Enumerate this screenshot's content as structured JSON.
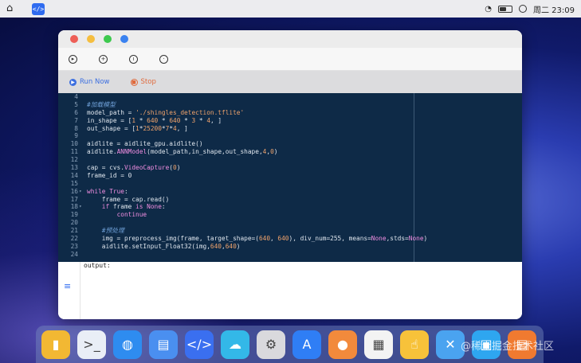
{
  "menubar": {
    "clock": "周二 23:09",
    "battery_level": 0.6
  },
  "window": {
    "toolbar_icons": [
      "play-circle-icon",
      "add-circle-icon",
      "clock-icon",
      "settings-icon"
    ],
    "actions": {
      "run_label": "Run Now",
      "stop_label": "Stop"
    }
  },
  "editor": {
    "lines": [
      {
        "n": "4",
        "text": ""
      },
      {
        "n": "5",
        "text": "#加载模型"
      },
      {
        "n": "6",
        "text": "model_path = './shingles_detection.tflite'"
      },
      {
        "n": "7",
        "text": "in_shape = [1 * 640 * 640 * 3 * 4, ]"
      },
      {
        "n": "8",
        "text": "out_shape = [1*25200*7*4, ]"
      },
      {
        "n": "9",
        "text": ""
      },
      {
        "n": "10",
        "text": "aidlite = aidlite_gpu.aidlite()"
      },
      {
        "n": "11",
        "text": "aidlite.ANNModel(model_path,in_shape,out_shape,4,0)"
      },
      {
        "n": "12",
        "text": ""
      },
      {
        "n": "13",
        "text": "cap = cvs.VideoCapture(0)"
      },
      {
        "n": "14",
        "text": "frame_id = 0"
      },
      {
        "n": "15",
        "text": ""
      },
      {
        "n": "16",
        "text": "while True:"
      },
      {
        "n": "17",
        "text": "    frame = cap.read()"
      },
      {
        "n": "18",
        "text": "    if frame is None:"
      },
      {
        "n": "19",
        "text": "        continue"
      },
      {
        "n": "20",
        "text": ""
      },
      {
        "n": "21",
        "text": "    #预处理"
      },
      {
        "n": "22",
        "text": "    img = preprocess_img(frame, target_shape=(640, 640), div_num=255, means=None,stds=None)"
      },
      {
        "n": "23",
        "text": "    aidlite.setInput_Float32(img,640,640)"
      },
      {
        "n": "24",
        "text": ""
      }
    ]
  },
  "output": {
    "label": "output:"
  },
  "dock": {
    "items": [
      {
        "name": "files-app-icon",
        "color": "#f2b833",
        "glyph": "▮"
      },
      {
        "name": "terminal-app-icon",
        "color": "#e9eef6",
        "glyph": ">_"
      },
      {
        "name": "browser-app-icon",
        "color": "#2e8cf0",
        "glyph": "◍"
      },
      {
        "name": "file-manager-app-icon",
        "color": "#4a8ff0",
        "glyph": "▤"
      },
      {
        "name": "code-editor-app-icon",
        "color": "#3a6ff0",
        "glyph": "</>"
      },
      {
        "name": "cloud-app-icon",
        "color": "#33b8e8",
        "glyph": "☁"
      },
      {
        "name": "settings-app-icon",
        "color": "#d9d9dd",
        "glyph": "⚙"
      },
      {
        "name": "app-store-app-icon",
        "color": "#2f7ef5",
        "glyph": "A"
      },
      {
        "name": "tips-app-icon",
        "color": "#f28a3c",
        "glyph": "●"
      },
      {
        "name": "calculator-app-icon",
        "color": "#f3f3f3",
        "glyph": "▦"
      },
      {
        "name": "touch-app-icon",
        "color": "#f7c23a",
        "glyph": "☝"
      },
      {
        "name": "tools-app-icon",
        "color": "#4aa3f0",
        "glyph": "✕"
      },
      {
        "name": "gift-app-icon",
        "color": "#2ea6f0",
        "glyph": "▣"
      },
      {
        "name": "toolbox-app-icon",
        "color": "#f07a30",
        "glyph": "▤"
      }
    ],
    "watermark": "@稀土掘金技术社区"
  }
}
